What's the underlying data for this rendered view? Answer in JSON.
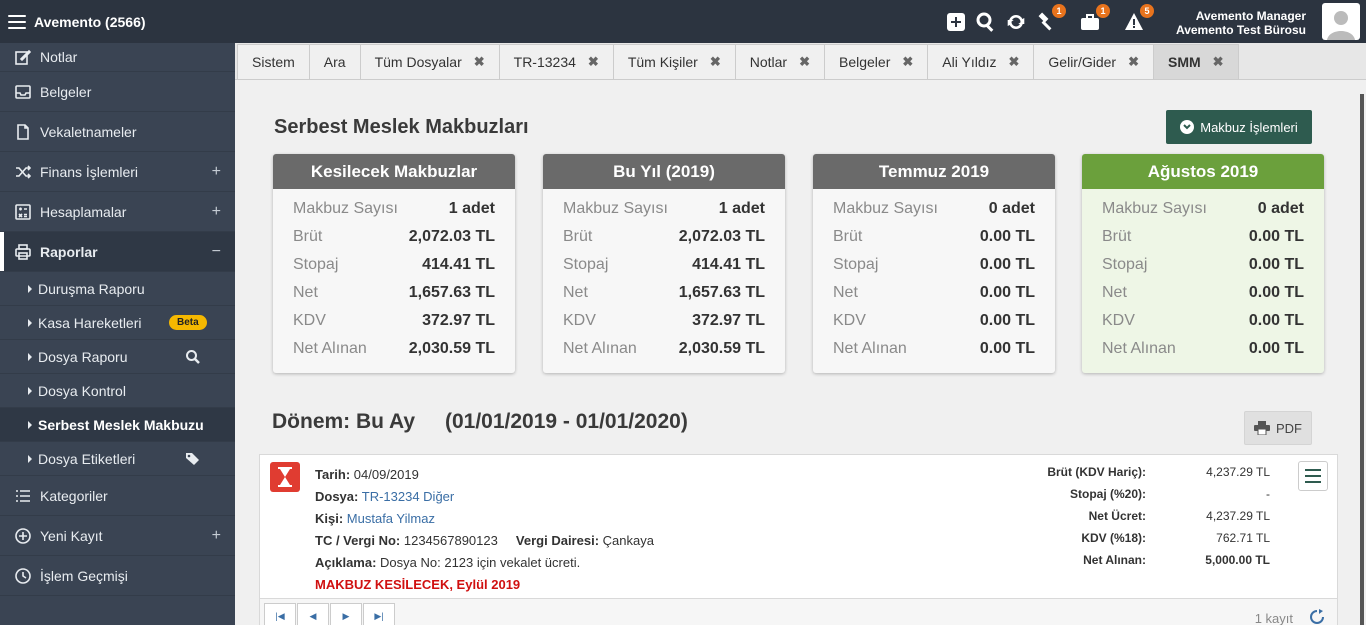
{
  "app": {
    "title": "Avemento (2566)"
  },
  "topbar": {
    "badges": {
      "hammer": "1",
      "briefcase": "1",
      "alert": "5"
    },
    "user_name": "Avemento Manager",
    "user_office": "Avemento Test Bürosu"
  },
  "sidebar": {
    "items": [
      {
        "label": "Notlar",
        "icon": "edit-icon"
      },
      {
        "label": "Belgeler",
        "icon": "inbox-icon"
      },
      {
        "label": "Vekaletnameler",
        "icon": "file-icon"
      },
      {
        "label": "Finans İşlemleri",
        "icon": "shuffle-icon",
        "toggle": "+"
      },
      {
        "label": "Hesaplamalar",
        "icon": "calculator-icon",
        "toggle": "+"
      },
      {
        "label": "Raporlar",
        "icon": "printer-icon",
        "toggle": "−"
      }
    ],
    "subitems": [
      {
        "label": "Duruşma Raporu"
      },
      {
        "label": "Kasa Hareketleri",
        "badge": "Beta"
      },
      {
        "label": "Dosya Raporu"
      },
      {
        "label": "Dosya Kontrol"
      },
      {
        "label": "Serbest Meslek Makbuzu"
      },
      {
        "label": "Dosya Etiketleri"
      }
    ],
    "bottom_items": [
      {
        "label": "Kategoriler",
        "icon": "list-icon"
      },
      {
        "label": "Yeni Kayıt",
        "icon": "plus-circle-icon",
        "toggle": "+"
      },
      {
        "label": "İşlem Geçmişi",
        "icon": "history-icon"
      }
    ]
  },
  "tabs": [
    {
      "label": "Sistem"
    },
    {
      "label": "Ara"
    },
    {
      "label": "Tüm Dosyalar",
      "close": "✖"
    },
    {
      "label": "TR-13234",
      "close": "✖"
    },
    {
      "label": "Tüm Kişiler",
      "close": "✖"
    },
    {
      "label": "Notlar",
      "close": "✖"
    },
    {
      "label": "Belgeler",
      "close": "✖"
    },
    {
      "label": "Ali Yıldız",
      "close": "✖"
    },
    {
      "label": "Gelir/Gider",
      "close": "✖"
    },
    {
      "label": "SMM",
      "close": "✖"
    }
  ],
  "main": {
    "title": "Serbest Meslek Makbuzları",
    "action_button": "Makbuz İşlemleri",
    "row_labels": [
      "Makbuz Sayısı",
      "Brüt",
      "Stopaj",
      "Net",
      "KDV",
      "Net Alınan"
    ],
    "cards": [
      {
        "title": "Kesilecek Makbuzlar",
        "values": [
          "1 adet",
          "2,072.03 TL",
          "414.41 TL",
          "1,657.63 TL",
          "372.97 TL",
          "2,030.59 TL"
        ]
      },
      {
        "title": "Bu Yıl (2019)",
        "values": [
          "1 adet",
          "2,072.03 TL",
          "414.41 TL",
          "1,657.63 TL",
          "372.97 TL",
          "2,030.59 TL"
        ]
      },
      {
        "title": "Temmuz 2019",
        "values": [
          "0 adet",
          "0.00 TL",
          "0.00 TL",
          "0.00 TL",
          "0.00 TL",
          "0.00 TL"
        ]
      },
      {
        "title": "Ağustos 2019",
        "values": [
          "0 adet",
          "0.00 TL",
          "0.00 TL",
          "0.00 TL",
          "0.00 TL",
          "0.00 TL"
        ],
        "accent": "#6ba03c"
      }
    ],
    "period_label": "Dönem: Bu Ay",
    "period_range": "(01/01/2019 - 01/01/2020)",
    "pdf_button": "PDF"
  },
  "record": {
    "tarih_label": "Tarih:",
    "tarih": "04/09/2019",
    "dosya_label": "Dosya:",
    "dosya": "TR-13234 Diğer",
    "kisi_label": "Kişi:",
    "kisi": "Mustafa Yilmaz",
    "tc_label": "TC / Vergi No:",
    "tc": "1234567890123",
    "vd_label": "Vergi Dairesi:",
    "vd": "Çankaya",
    "aciklama_label": "Açıklama:",
    "aciklama": "Dosya No: 2123 için vekalet ücreti.",
    "status": "MAKBUZ KESİLECEK, Eylül 2019",
    "summary": [
      {
        "label": "Brüt (KDV Hariç):",
        "value": "4,237.29 TL"
      },
      {
        "label": "Stopaj (%20):",
        "value": "-"
      },
      {
        "label": "Net Ücret:",
        "value": "4,237.29 TL"
      },
      {
        "label": "KDV (%18):",
        "value": "762.71 TL"
      },
      {
        "label": "Net Alınan:",
        "value": "5,000.00 TL"
      }
    ]
  },
  "pager": {
    "count": "1 kayıt"
  },
  "colors": {
    "topbar": "#2c3440",
    "sidebar": "#3a4453",
    "primary_button": "#2e5b4f",
    "status_red": "#d01010",
    "badge_orange": "#e8731d"
  }
}
